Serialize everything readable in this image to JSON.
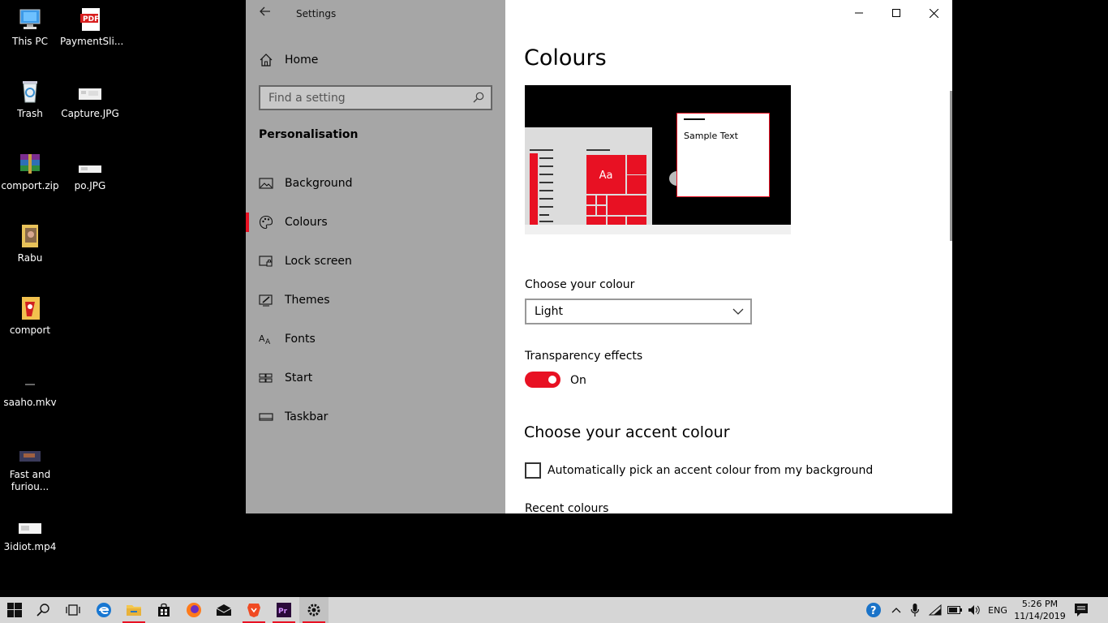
{
  "desktop": {
    "icons": [
      {
        "label": "This PC",
        "icon": "computer-icon"
      },
      {
        "label": "PaymentSli...",
        "icon": "pdf-file-icon"
      },
      {
        "label": "Trash",
        "icon": "recycle-bin-icon"
      },
      {
        "label": "Capture.JPG",
        "icon": "image-file-icon"
      },
      {
        "label": "comport.zip",
        "icon": "archive-icon"
      },
      {
        "label": "po.JPG",
        "icon": "image-file-icon"
      },
      {
        "label": "Rabu",
        "icon": "folder-icon"
      },
      {
        "label": "comport",
        "icon": "application-icon"
      },
      {
        "label": "saaho.mkv",
        "icon": "video-file-icon"
      },
      {
        "label": "Fast and\nfuriou...",
        "icon": "video-file-icon"
      },
      {
        "label": "3idiot.mp4",
        "icon": "video-file-icon"
      }
    ]
  },
  "window": {
    "title": "Settings",
    "accent_color": "#e81123",
    "sidebar_bg": "#a6a6a6"
  },
  "sidebar": {
    "home_label": "Home",
    "search_placeholder": "Find a setting",
    "section_title": "Personalisation",
    "items": [
      {
        "label": "Background",
        "icon": "picture-icon"
      },
      {
        "label": "Colours",
        "icon": "palette-icon",
        "active": true
      },
      {
        "label": "Lock screen",
        "icon": "lock-screen-icon"
      },
      {
        "label": "Themes",
        "icon": "themes-icon"
      },
      {
        "label": "Fonts",
        "icon": "fonts-icon"
      },
      {
        "label": "Start",
        "icon": "start-icon"
      },
      {
        "label": "Taskbar",
        "icon": "taskbar-icon"
      }
    ]
  },
  "main": {
    "title": "Colours",
    "preview": {
      "sample_text": "Sample Text",
      "tile_text": "Aa"
    },
    "choose_colour_label": "Choose your colour",
    "colour_selected": "Light",
    "transparency_label": "Transparency effects",
    "transparency_state": "On",
    "accent_heading": "Choose your accent colour",
    "auto_pick_label": "Automatically pick an accent colour from my background",
    "recent_colours_label": "Recent colours"
  },
  "taskbar": {
    "apps": [
      "start-icon",
      "search-icon",
      "task-view-icon",
      "edge-icon",
      "file-explorer-icon",
      "store-icon",
      "firefox-icon",
      "mail-icon",
      "brave-icon",
      "premiere-pro-icon",
      "settings-icon"
    ],
    "language": "ENG",
    "time": "5:26 PM",
    "date": "11/14/2019"
  }
}
